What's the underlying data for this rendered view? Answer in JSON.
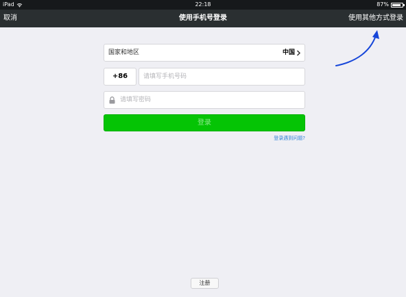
{
  "status_bar": {
    "device": "iPad",
    "time": "22:18",
    "battery_percent": "87%",
    "battery_level": 0.87
  },
  "nav": {
    "cancel_label": "取消",
    "title": "使用手机号登录",
    "other_login_label": "使用其他方式登录"
  },
  "form": {
    "country_label": "国家和地区",
    "country_value": "中国",
    "country_code": "+86",
    "phone_placeholder": "请填写手机号码",
    "phone_value": "",
    "password_placeholder": "请填写密码",
    "password_value": ""
  },
  "actions": {
    "login_label": "登录",
    "problem_link": "登录遇到问题?",
    "register_label": "注册"
  },
  "colors": {
    "nav_bg": "#2a2f31",
    "status_bg": "#16191b",
    "page_bg": "#efeff4",
    "login_green": "#05c405",
    "link_blue": "#2f82d6",
    "arrow_blue": "#1646d9"
  },
  "icons": {
    "wifi": "wifi-icon",
    "battery": "battery-icon",
    "chevron": "chevron-right-icon",
    "lock": "lock-icon",
    "arrow": "annotation-arrow-icon"
  }
}
